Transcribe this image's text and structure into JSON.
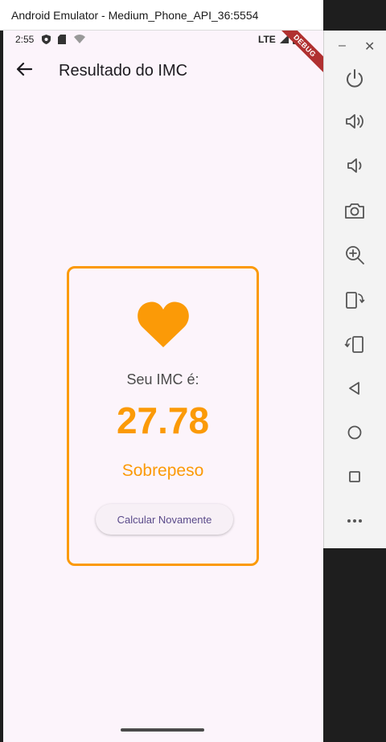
{
  "window": {
    "title": "Android Emulator - Medium_Phone_API_36:5554"
  },
  "statusbar": {
    "time": "2:55",
    "network": "LTE",
    "debug_ribbon": "DEBUG"
  },
  "appbar": {
    "title": "Resultado do IMC",
    "back_icon": "arrow-back-icon"
  },
  "result": {
    "label": "Seu IMC é:",
    "value": "27.78",
    "classification": "Sobrepeso",
    "button_label": "Calcular Novamente",
    "accent_color": "#fb9a07"
  },
  "emulator_controls": {
    "minimize": "–",
    "close": "✕",
    "buttons": [
      "power-icon",
      "volume-up-icon",
      "volume-down-icon",
      "camera-icon",
      "zoom-icon",
      "rotate-left-icon",
      "rotate-right-icon",
      "back-icon",
      "home-icon",
      "overview-icon",
      "more-icon"
    ]
  }
}
